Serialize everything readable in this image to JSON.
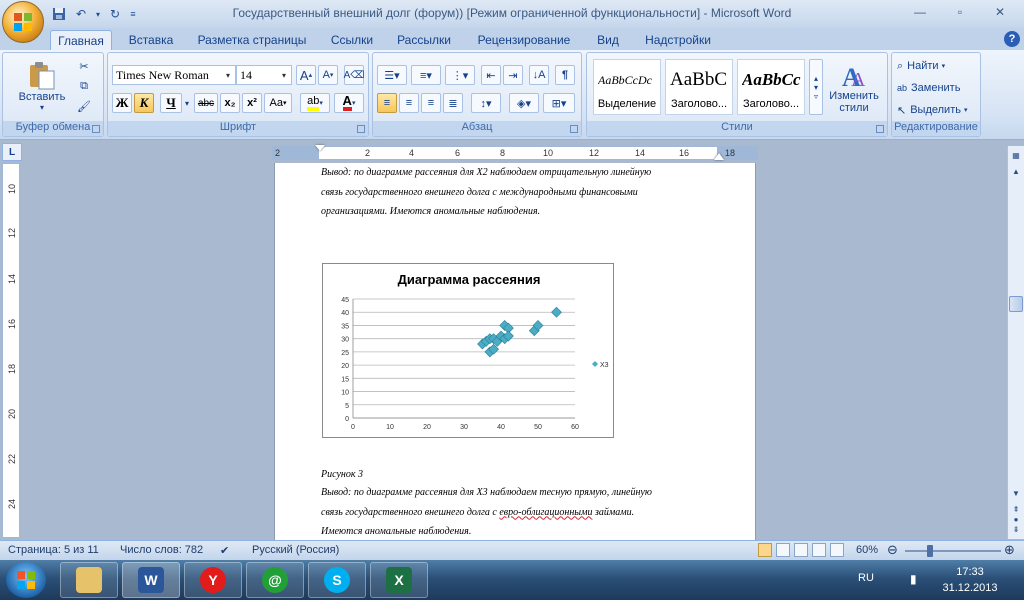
{
  "window": {
    "title": "Государственный внешний долг (форум)) [Режим ограниченной функциональности] - Microsoft Word"
  },
  "tabs": [
    {
      "label": "Главная",
      "active": true
    },
    {
      "label": "Вставка"
    },
    {
      "label": "Разметка страницы"
    },
    {
      "label": "Ссылки"
    },
    {
      "label": "Рассылки"
    },
    {
      "label": "Рецензирование"
    },
    {
      "label": "Вид"
    },
    {
      "label": "Надстройки"
    }
  ],
  "ribbon": {
    "clipboard": {
      "label": "Буфер обмена",
      "paste_label": "Вставить"
    },
    "font": {
      "label": "Шрифт",
      "font_name": "Times New Roman",
      "font_size": "14",
      "bold": "Ж",
      "italic": "К",
      "underline": "Ч",
      "strike": "abc",
      "subscript": "x₂",
      "superscript": "x²",
      "change_case": "Aa",
      "grow": "A",
      "shrink": "A"
    },
    "paragraph": {
      "label": "Абзац"
    },
    "styles": {
      "label": "Стили",
      "items": [
        {
          "sample": "AaBbCcDc",
          "name": "Выделение"
        },
        {
          "sample": "AaBbC",
          "name": "Заголово..."
        },
        {
          "sample": "AaBbCc",
          "name": "Заголово..."
        }
      ],
      "change_styles": "Изменить стили"
    },
    "editing": {
      "label": "Редактирование",
      "find": "Найти",
      "replace": "Заменить",
      "select": "Выделить"
    }
  },
  "ruler": {
    "h_numbers": [
      "2",
      "2",
      "4",
      "6",
      "8",
      "10",
      "12",
      "14",
      "16",
      "18"
    ],
    "v_numbers": [
      "10",
      "12",
      "14",
      "16",
      "18",
      "20",
      "22",
      "24"
    ]
  },
  "document": {
    "para1_line1": "Вывод: по диаграмме рассеяния для X2 наблюдаем отрицательную линейную",
    "para1_line2": "связь государственного внешнего  долга с международными  финансовыми",
    "para1_line3": "организациями. Имеются аномальные  наблюдения.",
    "caption": "Рисунок 3",
    "para2_line1": "Вывод: по диаграмме рассеяния для X3 наблюдаем тесную  прямую, линейную",
    "para2_line2_a": "связь государственного внешнего  долга с ",
    "para2_line2_b": "евро-облигационными",
    "para2_line2_c": " займами.",
    "para2_line3": "Имеются аномальные  наблюдения."
  },
  "chart_data": {
    "type": "scatter",
    "title": "Диаграмма рассеяния",
    "xlim": [
      0,
      60
    ],
    "ylim": [
      0,
      45
    ],
    "x_ticks": [
      0,
      10,
      20,
      30,
      40,
      50,
      60
    ],
    "y_ticks": [
      0,
      5,
      10,
      15,
      20,
      25,
      30,
      35,
      40,
      45
    ],
    "grid": "horizontal",
    "legend": "right",
    "series": [
      {
        "name": "X3",
        "color": "#4bacc6",
        "points": [
          [
            35,
            28
          ],
          [
            36,
            29
          ],
          [
            37,
            30
          ],
          [
            37,
            25
          ],
          [
            38,
            26
          ],
          [
            38,
            30
          ],
          [
            39,
            29
          ],
          [
            40,
            31
          ],
          [
            41,
            30
          ],
          [
            41,
            35
          ],
          [
            42,
            34
          ],
          [
            42,
            31
          ],
          [
            49,
            33
          ],
          [
            50,
            35
          ],
          [
            55,
            40
          ]
        ]
      }
    ]
  },
  "statusbar": {
    "page": "Страница: 5 из 11",
    "words": "Число слов: 782",
    "language": "Русский (Россия)",
    "zoom": "60%"
  },
  "taskbar": {
    "lang": "RU",
    "time": "17:33",
    "date": "31.12.2013"
  }
}
